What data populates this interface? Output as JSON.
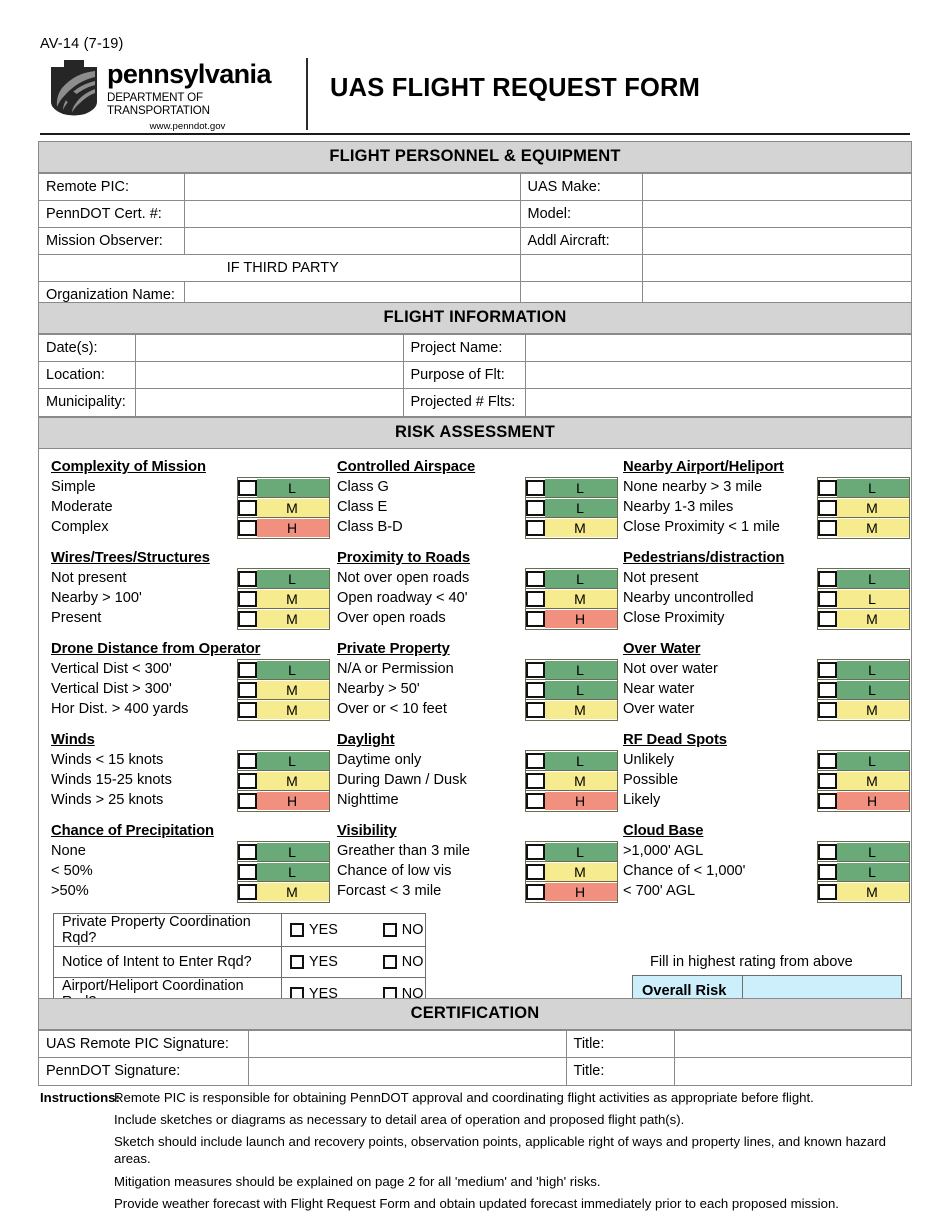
{
  "header": {
    "form_code": "AV-14 (7-19)",
    "logo_name": "pennsylvania",
    "logo_dept": "DEPARTMENT OF TRANSPORTATION",
    "logo_url": "www.penndot.gov",
    "title": "UAS FLIGHT REQUEST FORM"
  },
  "personnel": {
    "section_title": "FLIGHT PERSONNEL & EQUIPMENT",
    "rows": [
      {
        "left_label": "Remote PIC:",
        "left_value": "",
        "right_label": "UAS Make:",
        "right_value": ""
      },
      {
        "left_label": "PennDOT Cert. #:",
        "left_value": "",
        "right_label": "Model:",
        "right_value": ""
      },
      {
        "left_label": "Mission Observer:",
        "left_value": "",
        "right_label": "Addl Aircraft:",
        "right_value": ""
      }
    ],
    "third_party_label": "IF THIRD PARTY",
    "org_label": "Organization Name:",
    "org_value": ""
  },
  "flight_info": {
    "section_title": "FLIGHT INFORMATION",
    "rows": [
      {
        "left_label": "Date(s):",
        "left_value": "",
        "right_label": "Project Name:",
        "right_value": ""
      },
      {
        "left_label": "Location:",
        "left_value": "",
        "right_label": "Purpose of Flt:",
        "right_value": ""
      },
      {
        "left_label": "Municipality:",
        "left_value": "",
        "right_label": "Projected # Flts:",
        "right_value": ""
      }
    ]
  },
  "risk": {
    "section_title": "RISK ASSESSMENT",
    "columns": [
      {
        "groups": [
          {
            "title": "Complexity of Mission",
            "items": [
              {
                "label": "Simple",
                "level": "L"
              },
              {
                "label": "Moderate",
                "level": "M"
              },
              {
                "label": "Complex",
                "level": "H"
              }
            ]
          },
          {
            "title": "Wires/Trees/Structures",
            "items": [
              {
                "label": "Not present",
                "level": "L"
              },
              {
                "label": "Nearby > 100'",
                "level": "M"
              },
              {
                "label": "Present",
                "level": "M"
              }
            ]
          },
          {
            "title": "Drone Distance from Operator",
            "items": [
              {
                "label": "Vertical Dist < 300'",
                "level": "L"
              },
              {
                "label": "Vertical Dist > 300'",
                "level": "M"
              },
              {
                "label": "Hor Dist. > 400 yards",
                "level": "M"
              }
            ]
          },
          {
            "title": "Winds",
            "items": [
              {
                "label": "Winds < 15 knots",
                "level": "L"
              },
              {
                "label": "Winds 15-25 knots",
                "level": "M"
              },
              {
                "label": "Winds > 25 knots",
                "level": "H"
              }
            ]
          },
          {
            "title": "Chance of Precipitation",
            "items": [
              {
                "label": "None",
                "level": "L"
              },
              {
                "label": "< 50%",
                "level": "L"
              },
              {
                "label": ">50%",
                "level": "M"
              }
            ]
          }
        ]
      },
      {
        "groups": [
          {
            "title": "Controlled Airspace",
            "items": [
              {
                "label": "Class G",
                "level": "L"
              },
              {
                "label": "Class E",
                "level": "L"
              },
              {
                "label": "Class B-D",
                "level": "M"
              }
            ]
          },
          {
            "title": "Proximity to Roads",
            "items": [
              {
                "label": "Not over open roads",
                "level": "L"
              },
              {
                "label": "Open roadway < 40'",
                "level": "M"
              },
              {
                "label": "Over open roads",
                "level": "H"
              }
            ]
          },
          {
            "title": "Private Property",
            "items": [
              {
                "label": "N/A or Permission",
                "level": "L"
              },
              {
                "label": "Nearby > 50'",
                "level": "L"
              },
              {
                "label": "Over or < 10 feet",
                "level": "M"
              }
            ]
          },
          {
            "title": "Daylight",
            "items": [
              {
                "label": "Daytime only",
                "level": "L"
              },
              {
                "label": "During Dawn / Dusk",
                "level": "M"
              },
              {
                "label": "Nighttime",
                "level": "H"
              }
            ]
          },
          {
            "title": "Visibility",
            "items": [
              {
                "label": "Greather than 3 mile",
                "level": "L"
              },
              {
                "label": "Chance of low vis",
                "level": "M"
              },
              {
                "label": "Forcast < 3 mile",
                "level": "H"
              }
            ]
          }
        ]
      },
      {
        "groups": [
          {
            "title": "Nearby Airport/Heliport",
            "items": [
              {
                "label": "None nearby > 3 mile",
                "level": "L"
              },
              {
                "label": "Nearby 1-3 miles",
                "level": "M"
              },
              {
                "label": "Close Proximity < 1 mile",
                "level": "M"
              }
            ]
          },
          {
            "title": "Pedestrians/distraction",
            "items": [
              {
                "label": "Not present",
                "level": "L"
              },
              {
                "label": "Nearby uncontrolled",
                "level": "L",
                "fill": "M"
              },
              {
                "label": "Close Proximity",
                "level": "M"
              }
            ]
          },
          {
            "title": "Over Water",
            "items": [
              {
                "label": "Not over water",
                "level": "L"
              },
              {
                "label": "Near water",
                "level": "L"
              },
              {
                "label": "Over water",
                "level": "M"
              }
            ]
          },
          {
            "title": "RF Dead Spots",
            "items": [
              {
                "label": "Unlikely",
                "level": "L"
              },
              {
                "label": "Possible",
                "level": "M"
              },
              {
                "label": "Likely",
                "level": "H"
              }
            ]
          },
          {
            "title": "Cloud Base",
            "items": [
              {
                "label": ">1,000' AGL",
                "level": "L"
              },
              {
                "label": "Chance of < 1,000'",
                "level": "L"
              },
              {
                "label": "< 700' AGL",
                "level": "M"
              }
            ]
          }
        ]
      }
    ],
    "coordination": [
      {
        "question": "Private Property Coordination Rqd?",
        "yes": "YES",
        "no": "NO"
      },
      {
        "question": "Notice of Intent to Enter Rqd?",
        "yes": "YES",
        "no": "NO"
      },
      {
        "question": "Airport/Heliport Coordination Rqd?",
        "yes": "YES",
        "no": "NO"
      }
    ],
    "overall_note": "Fill in highest rating from above",
    "overall_label": "Overall Risk",
    "overall_value": ""
  },
  "certification": {
    "section_title": "CERTIFICATION",
    "rows": [
      {
        "label": "UAS Remote PIC Signature:",
        "value": "",
        "title_label": "Title:",
        "title_value": ""
      },
      {
        "label": "PennDOT Signature:",
        "value": "",
        "title_label": "Title:",
        "title_value": ""
      }
    ]
  },
  "instructions": {
    "label": "Instructions:",
    "lines": [
      "Remote PIC is responsible for obtaining PennDOT approval and coordinating flight activities as appropriate before flight.",
      "Include sketches or diagrams as necessary to detail area of operation and proposed flight path(s).",
      "Sketch should include launch and recovery points, observation points, applicable right of ways and property lines, and known hazard areas.",
      "Mitigation measures should be explained on page 2 for all 'medium' and 'high' risks.",
      "Provide weather forecast with Flight Request Form and obtain updated forecast immediately prior to each proposed mission."
    ]
  },
  "colors": {
    "low": "#6aaa78",
    "medium": "#f7eb8f",
    "high": "#f1907f",
    "section_header": "#d4d4d4",
    "overall_risk": "#cdeefb"
  }
}
